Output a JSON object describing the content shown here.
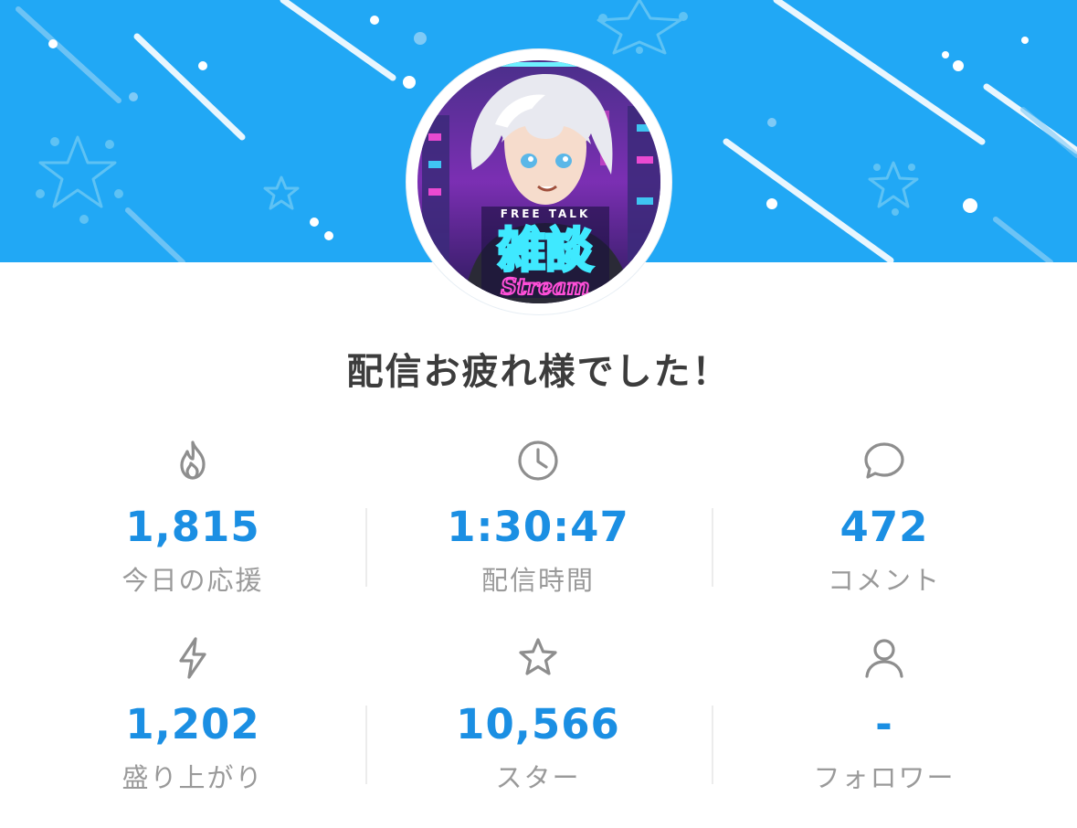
{
  "colors": {
    "banner": "#21a8f5",
    "accent": "#1b8fe3",
    "label": "#9a9a9a",
    "title": "#3c3c3c"
  },
  "header": {
    "title": "配信お疲れ様でした！"
  },
  "avatar": {
    "description_text": [
      "FREE TALK",
      "雑談",
      "Stream"
    ]
  },
  "stats": [
    {
      "icon": "fire-icon",
      "value": "1,815",
      "label": "今日の応援"
    },
    {
      "icon": "clock-icon",
      "value": "1:30:47",
      "label": "配信時間"
    },
    {
      "icon": "comment-icon",
      "value": "472",
      "label": "コメント"
    },
    {
      "icon": "lightning-icon",
      "value": "1,202",
      "label": "盛り上がり"
    },
    {
      "icon": "star-icon",
      "value": "10,566",
      "label": "スター"
    },
    {
      "icon": "person-icon",
      "value": "-",
      "label": "フォロワー"
    }
  ]
}
